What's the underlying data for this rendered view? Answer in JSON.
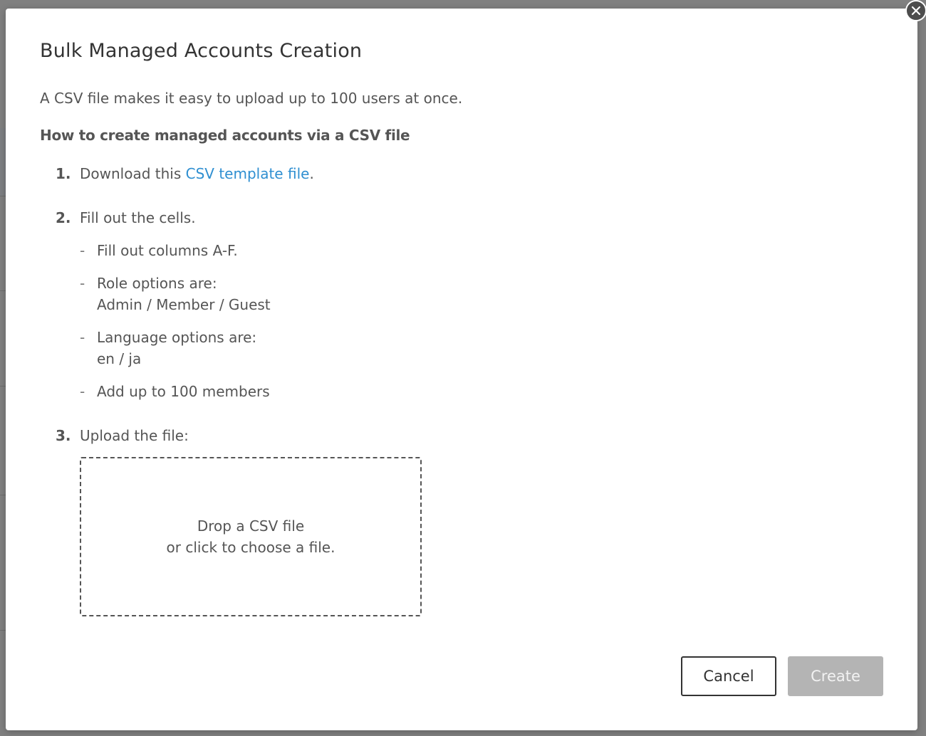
{
  "modal": {
    "title": "Bulk Managed Accounts Creation",
    "intro": "A CSV file makes it easy to upload up to 100 users at once.",
    "how_heading": "How to create managed accounts via a CSV file",
    "close_icon": "close-icon"
  },
  "steps": [
    {
      "num": "1.",
      "text_before": "Download this ",
      "link": "CSV template file",
      "text_after": "."
    },
    {
      "num": "2.",
      "text": "Fill out the cells."
    },
    {
      "num": "3.",
      "text": "Upload the file:"
    }
  ],
  "bullets": [
    {
      "line1": "Fill out columns A-F.",
      "line2": ""
    },
    {
      "line1": "Role options are:",
      "line2": "Admin / Member / Guest"
    },
    {
      "line1": "Language options are:",
      "line2": "en / ja"
    },
    {
      "line1": "Add up to 100 members",
      "line2": ""
    }
  ],
  "bullet_dash": "-",
  "dropzone": {
    "line1": "Drop a CSV file",
    "line2": "or click to choose a file."
  },
  "buttons": {
    "cancel": "Cancel",
    "create": "Create"
  },
  "colors": {
    "link": "#2f8fd1",
    "create_disabled_bg": "#b4b4b4",
    "overlay": "#808080"
  }
}
